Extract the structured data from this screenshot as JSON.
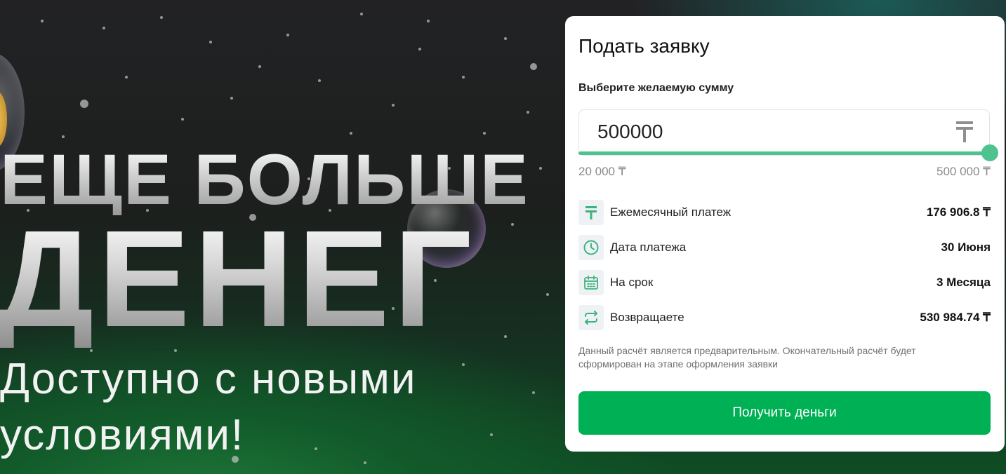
{
  "hero": {
    "line1": "ЕЩЕ БОЛЬШЕ",
    "line2": "ДЕНЕГ",
    "line3": "Доступно с новыми",
    "line4": "условиями!"
  },
  "form": {
    "title": "Подать заявку",
    "sum_label": "Выберите желаемую сумму",
    "amount_value": "500000",
    "currency_icon": "tenge-icon",
    "slider": {
      "level": 1.0,
      "min_label": "20 000 ₸",
      "max_label": "500 000 ₸"
    },
    "rows": [
      {
        "icon": "tenge-icon",
        "label": "Ежемесячный платеж",
        "value": "176 906.8 ₸"
      },
      {
        "icon": "clock-icon",
        "label": "Дата платежа",
        "value": "30 Июня"
      },
      {
        "icon": "calendar-icon",
        "label": "На срок",
        "value": "3 Месяца"
      },
      {
        "icon": "repeat-icon",
        "label": "Возвращаете",
        "value": "530 984.74 ₸"
      }
    ],
    "disclaimer": "Данный расчёт является предварительным. Окончательный расчёт будет сформирован на этапе оформления заявки",
    "submit_label": "Получить деньги"
  },
  "colors": {
    "accent": "#00b054",
    "slider": "#4fc38f",
    "icon_green": "#3fb37f"
  }
}
